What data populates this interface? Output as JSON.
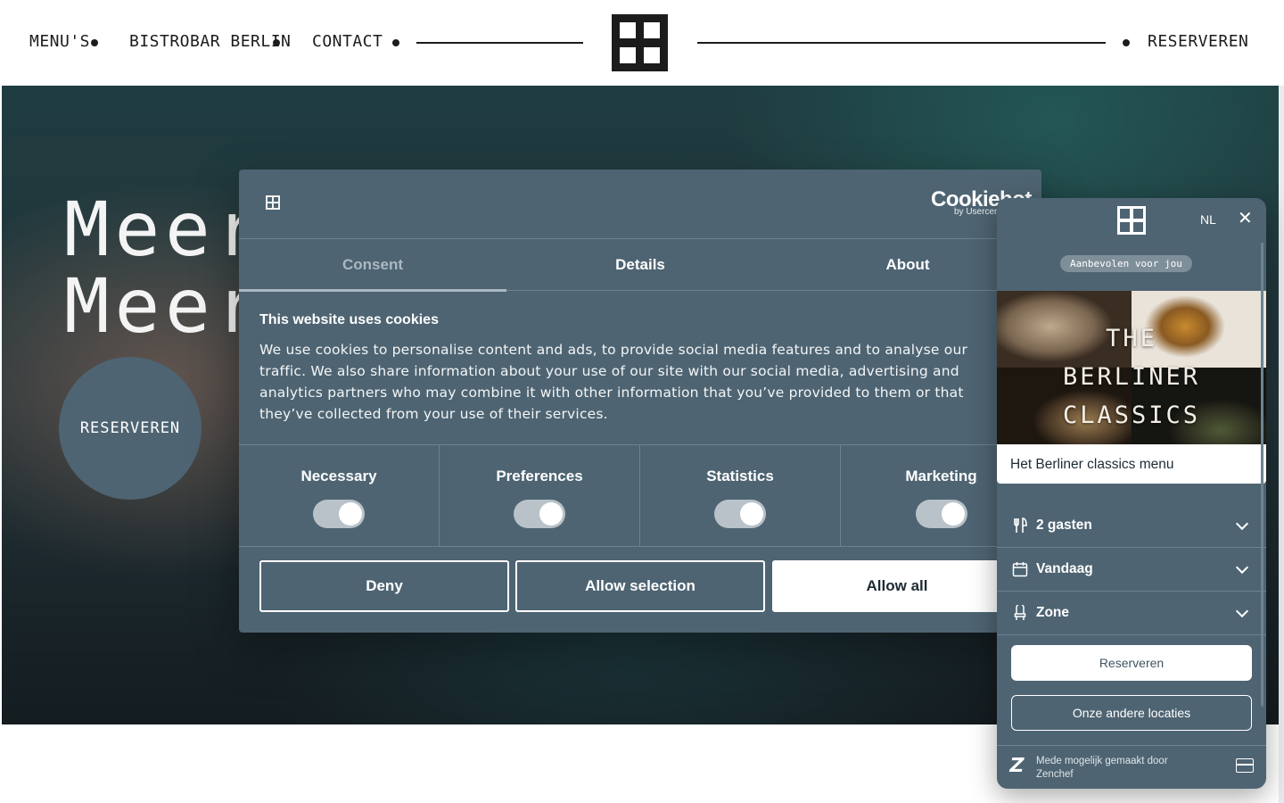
{
  "nav": {
    "menus": "MENU'S",
    "bistrobar": "BISTROBAR BERLIN",
    "contact": "CONTACT",
    "reserve": "RESERVEREN"
  },
  "hero": {
    "line1": "Meer",
    "line2": "Meer",
    "cta": "RESERVEREN"
  },
  "cookie": {
    "brand": "Cookiebot",
    "brand_by": "by Usercentrics",
    "tabs": [
      "Consent",
      "Details",
      "About"
    ],
    "active_tab": "Consent",
    "title": "This website uses cookies",
    "body": "We use cookies to personalise content and ads, to provide social media features and to analyse our traffic. We also share information about your use of our site with our social media, advertising and analytics partners who may combine it with other information that you’ve provided to them or that they’ve collected from your use of their services.",
    "categories": [
      {
        "label": "Necessary",
        "enabled": true
      },
      {
        "label": "Preferences",
        "enabled": true
      },
      {
        "label": "Statistics",
        "enabled": true
      },
      {
        "label": "Marketing",
        "enabled": true
      }
    ],
    "buttons": {
      "deny": "Deny",
      "allow_selection": "Allow selection",
      "allow_all": "Allow all"
    }
  },
  "widget": {
    "lang": "NL",
    "chip": "Aanbevolen voor jou",
    "card_image_text": [
      "THE",
      "BERLINER",
      "CLASSICS"
    ],
    "card_title": "Het Berliner classics menu",
    "guests": "2 gasten",
    "date": "Vandaag",
    "zone": "Zone",
    "reserve_button": "Reserveren",
    "other_locations": "Onze andere locaties",
    "powered_by": "Mede mogelijk gemaakt door Zenchef"
  },
  "colors": {
    "panel": "#4e6472",
    "nav_text": "#1c1c1c",
    "white": "#ffffff"
  }
}
